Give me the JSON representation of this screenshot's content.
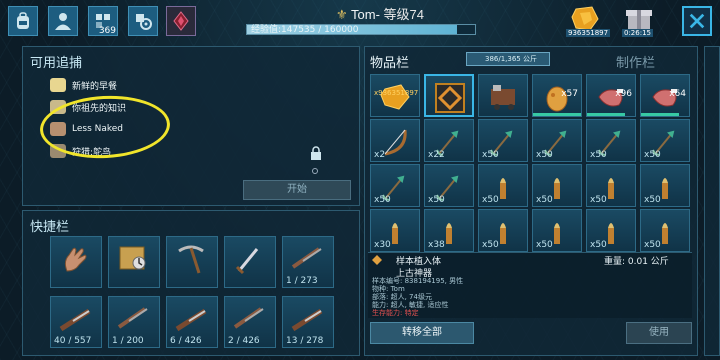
{
  "header": {
    "player_name": "Tom-",
    "level_label": "等级74",
    "xp_text": "经验值:147535 / 160000",
    "xp_fraction": 0.922,
    "implant_count": "369",
    "currency_value": "936351897",
    "timer": "0:26:15"
  },
  "left_panel": {
    "title": "可用追捕",
    "items": [
      {
        "label": "新鲜的早餐",
        "color": "#e8d690"
      },
      {
        "label": "你祖先的知识",
        "color": "#c9b98a"
      },
      {
        "label": "Less Naked",
        "color": "#b89070"
      },
      {
        "label": "狩猎:鸵鸟",
        "color": "#9a8a70"
      }
    ],
    "start_button": "开始"
  },
  "hotbar": {
    "title": "快捷栏",
    "slots": [
      {
        "icon": "hand-icon",
        "qty": ""
      },
      {
        "icon": "map-icon",
        "qty": ""
      },
      {
        "icon": "pickaxe-icon",
        "qty": ""
      },
      {
        "icon": "sword-icon",
        "qty": ""
      },
      {
        "icon": "rifle-icon",
        "qty": "1 / 273"
      },
      {
        "icon": "shotgun-icon",
        "qty": "40 / 557"
      },
      {
        "icon": "rifle-icon",
        "qty": "1 / 200"
      },
      {
        "icon": "shotgun-icon",
        "qty": "6 / 426"
      },
      {
        "icon": "rifle-icon",
        "qty": "2 / 426"
      },
      {
        "icon": "shotgun-icon",
        "qty": "13 / 278"
      }
    ]
  },
  "inventory": {
    "tab_active": "物品栏",
    "tab_other": "制作栏",
    "weight": "386/1,365 公斤",
    "slots": [
      {
        "icon": "amber-icon",
        "qty": "x936351897",
        "pos": "top-left"
      },
      {
        "icon": "artifact-icon",
        "qty": "",
        "pos": ""
      },
      {
        "icon": "machine-icon",
        "qty": "",
        "pos": ""
      },
      {
        "icon": "egg-icon",
        "qty": "x57",
        "pos": "top-right"
      },
      {
        "icon": "meat-icon",
        "qty": "x96",
        "pos": "top-right"
      },
      {
        "icon": "meat-icon",
        "qty": "x64",
        "pos": "top-right"
      },
      {
        "icon": "bow-icon",
        "qty": "x2",
        "pos": ""
      },
      {
        "icon": "arrow-icon",
        "qty": "x22",
        "pos": ""
      },
      {
        "icon": "arrow-icon",
        "qty": "x50",
        "pos": ""
      },
      {
        "icon": "arrow-icon",
        "qty": "x50",
        "pos": ""
      },
      {
        "icon": "arrow-icon",
        "qty": "x50",
        "pos": ""
      },
      {
        "icon": "arrow-icon",
        "qty": "x50",
        "pos": ""
      },
      {
        "icon": "arrow-icon",
        "qty": "x50",
        "pos": ""
      },
      {
        "icon": "arrow-icon",
        "qty": "x50",
        "pos": ""
      },
      {
        "icon": "bullet-icon",
        "qty": "x50",
        "pos": ""
      },
      {
        "icon": "bullet-icon",
        "qty": "x50",
        "pos": ""
      },
      {
        "icon": "bullet-icon",
        "qty": "x50",
        "pos": ""
      },
      {
        "icon": "bullet-icon",
        "qty": "x50",
        "pos": ""
      },
      {
        "icon": "bullet-icon",
        "qty": "x30",
        "pos": ""
      },
      {
        "icon": "bullet-icon",
        "qty": "x38",
        "pos": ""
      },
      {
        "icon": "bullet-icon",
        "qty": "x50",
        "pos": ""
      },
      {
        "icon": "bullet-icon",
        "qty": "x50",
        "pos": ""
      },
      {
        "icon": "bullet-icon",
        "qty": "x50",
        "pos": ""
      },
      {
        "icon": "bullet-icon",
        "qty": "x50",
        "pos": ""
      }
    ],
    "item_name": "样本植入体",
    "item_type": "上古神器",
    "item_weight": "重量: 0.01 公斤",
    "stat_lines": [
      "样本编号: 838194195, 男性",
      "物种: Tom",
      "部落: 超人, 74级元",
      "能力: 超人, 敏捷, 适应性",
      "生存能力: 特定"
    ],
    "transfer_button": "转移全部",
    "use_button": "使用"
  }
}
